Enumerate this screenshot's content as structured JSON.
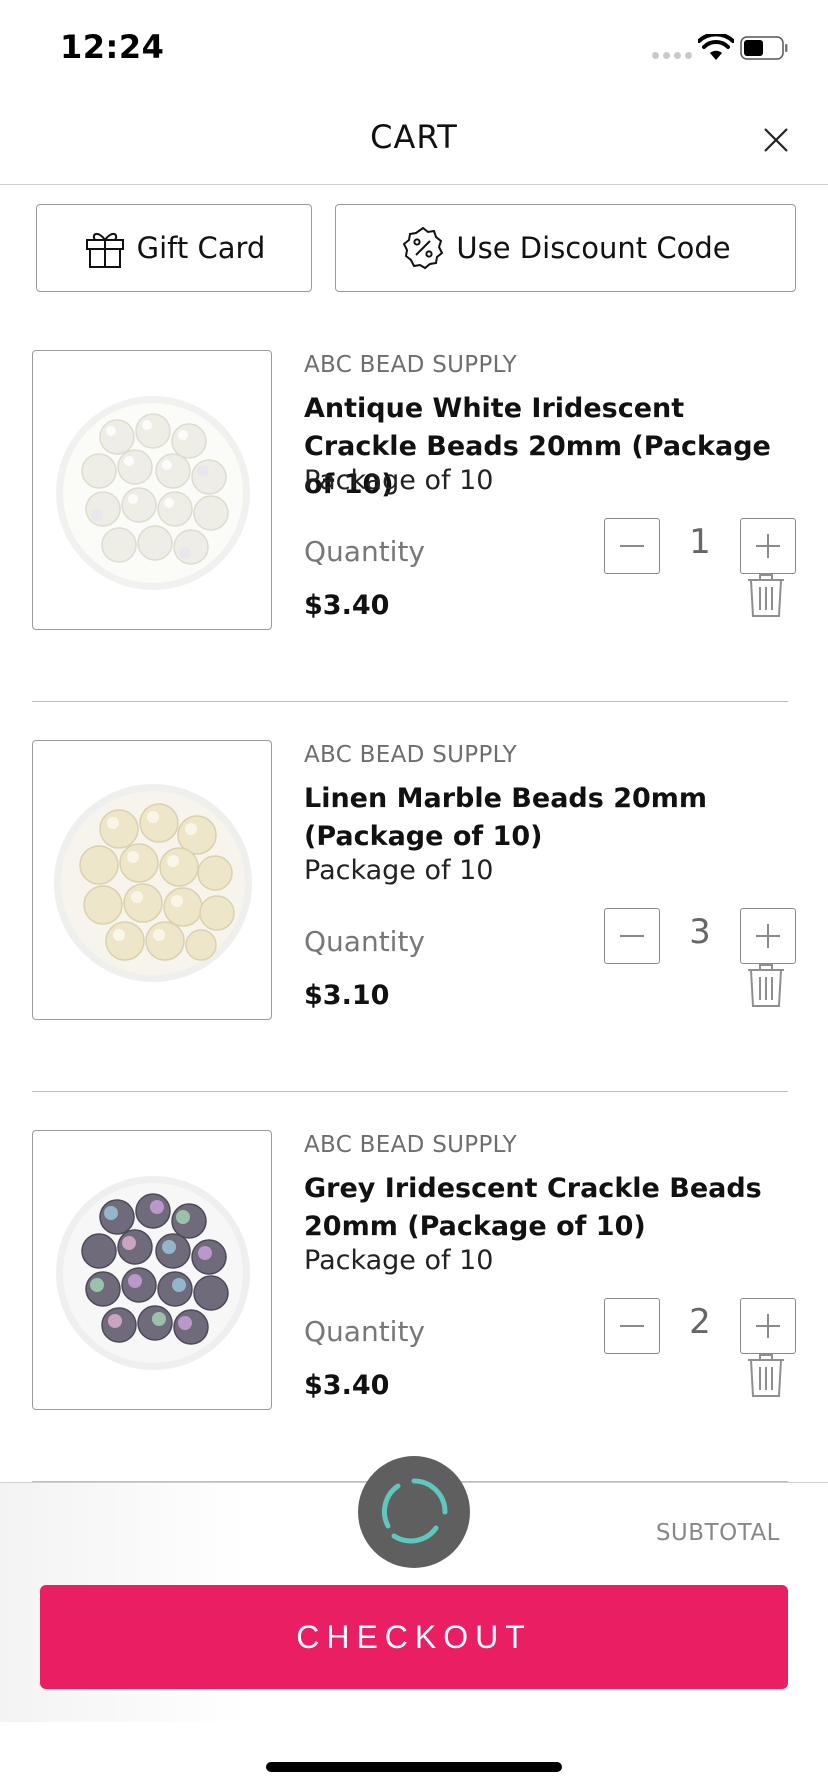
{
  "status_bar": {
    "time": "12:24"
  },
  "header": {
    "title": "CART"
  },
  "actions": {
    "gift_card": "Gift Card",
    "discount": "Use Discount Code"
  },
  "items": [
    {
      "vendor": "ABC BEAD SUPPLY",
      "name": "Antique White Iridescent Crackle Beads 20mm (Package of 10)",
      "variant": "Package of 10",
      "quantity_label": "Quantity",
      "quantity": "1",
      "price": "$3.40"
    },
    {
      "vendor": "ABC BEAD SUPPLY",
      "name": "Linen Marble Beads 20mm (Package of 10)",
      "variant": "Package of 10",
      "quantity_label": "Quantity",
      "quantity": "3",
      "price": "$3.10"
    },
    {
      "vendor": "ABC BEAD SUPPLY",
      "name": "Grey Iridescent Crackle Beads 20mm (Package of 10)",
      "variant": "Package of 10",
      "quantity_label": "Quantity",
      "quantity": "2",
      "price": "$3.40"
    }
  ],
  "footer": {
    "subtotal_label": "SUBTOTAL",
    "checkout_label": "CHECKOUT"
  },
  "colors": {
    "checkout": "#ea1f63",
    "loader": "#5f5f5f",
    "loader_ring": "#5fc7bd"
  },
  "icons": [
    "close-icon",
    "gift-icon",
    "discount-badge-icon",
    "minus-icon",
    "plus-icon",
    "trash-icon",
    "loading-spinner-icon",
    "wifi-icon",
    "battery-icon"
  ]
}
